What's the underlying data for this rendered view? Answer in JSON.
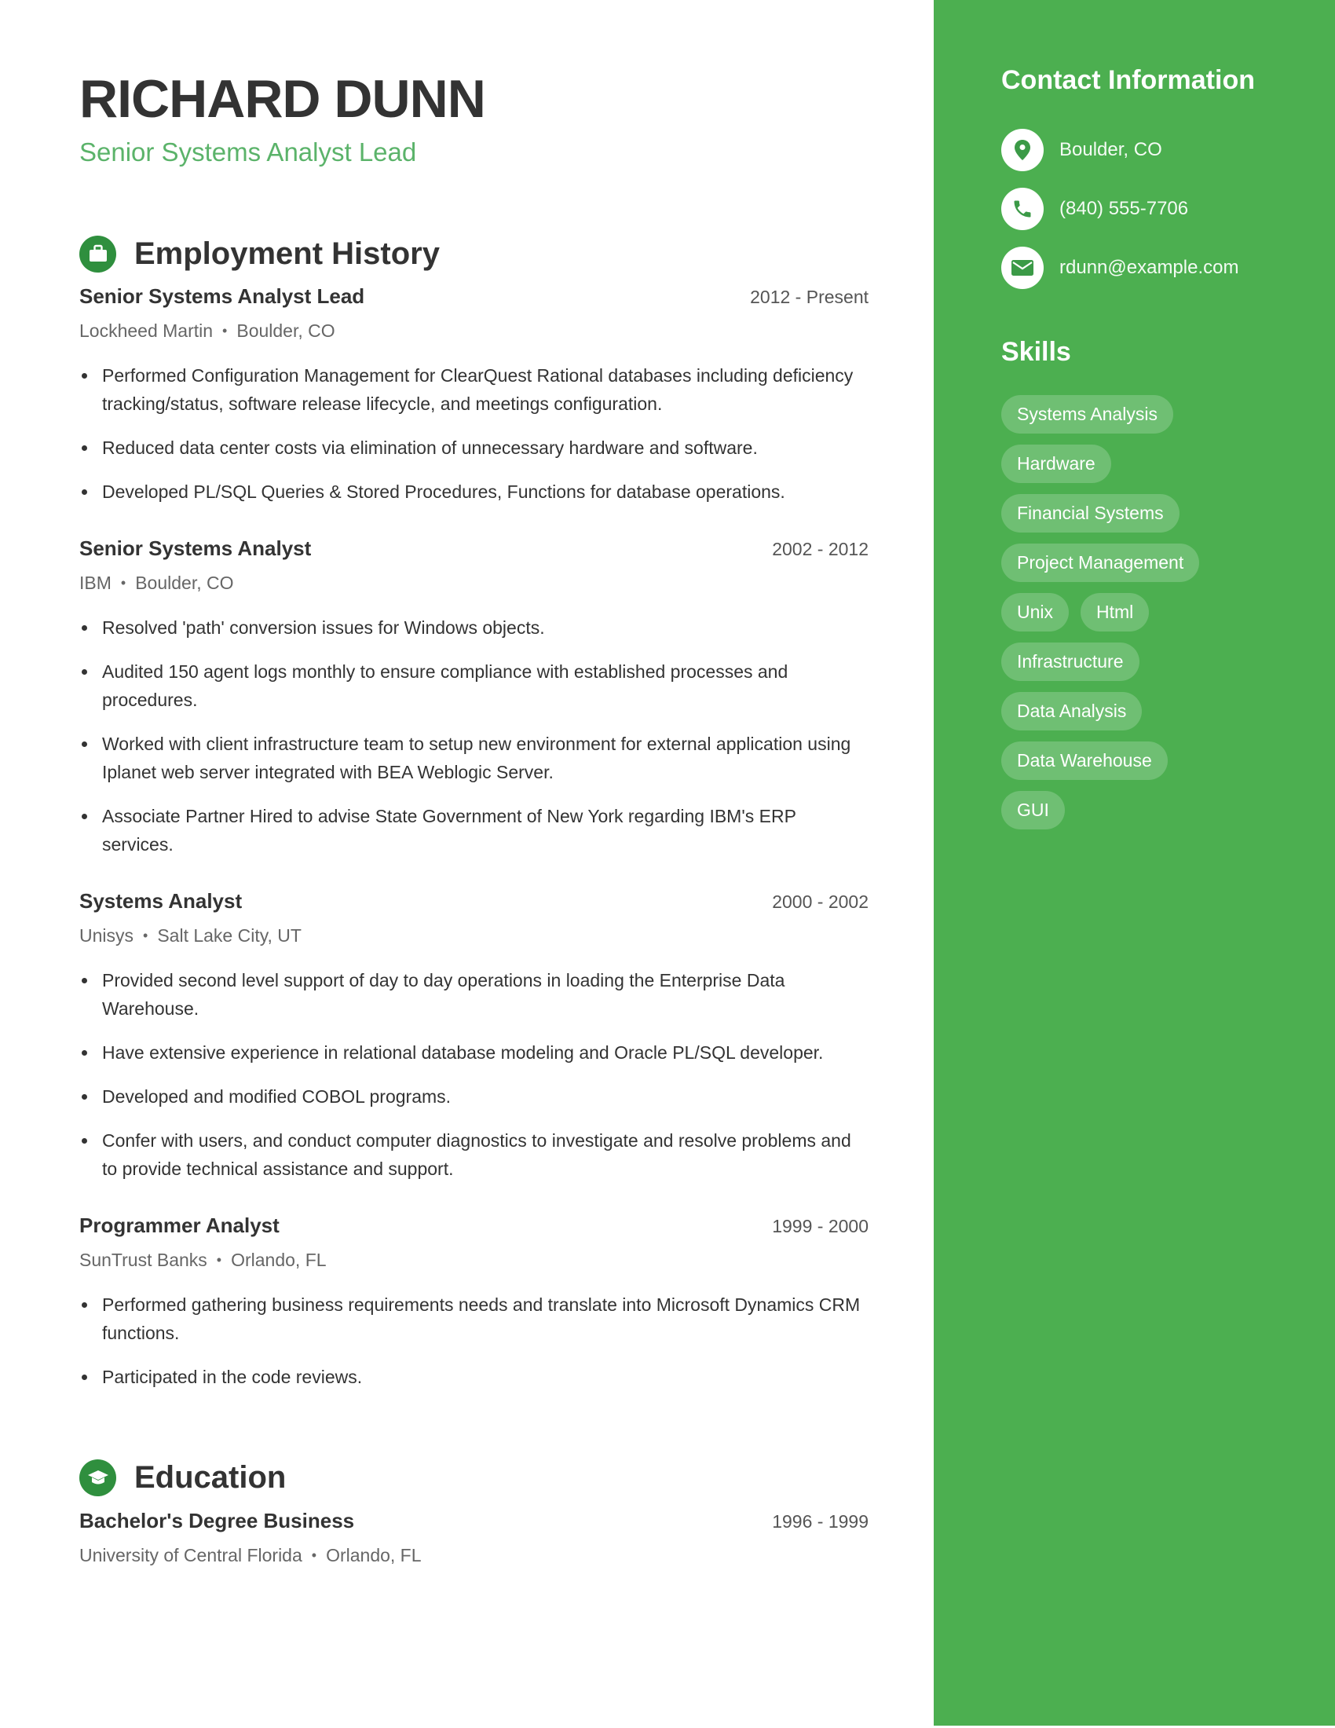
{
  "header": {
    "name": "RICHARD DUNN",
    "title": "Senior Systems Analyst Lead"
  },
  "employment": {
    "heading": "Employment History",
    "icon": "briefcase-icon",
    "jobs": [
      {
        "title": "Senior Systems Analyst Lead",
        "dates": "2012 - Present",
        "company": "Lockheed Martin",
        "location": "Boulder, CO",
        "bullets": [
          "Performed Configuration Management for ClearQuest Rational databases including deficiency tracking/status, software release lifecycle, and meetings configuration.",
          "Reduced data center costs via elimination of unnecessary hardware and software.",
          "Developed PL/SQL Queries & Stored Procedures, Functions for database operations."
        ]
      },
      {
        "title": "Senior Systems Analyst",
        "dates": "2002 - 2012",
        "company": "IBM",
        "location": "Boulder, CO",
        "bullets": [
          "Resolved 'path' conversion issues for Windows objects.",
          "Audited 150 agent logs monthly to ensure compliance with established processes and procedures.",
          "Worked with client infrastructure team to setup new environment for external application using Iplanet web server integrated with BEA Weblogic Server.",
          "Associate Partner Hired to advise State Government of New York regarding IBM's ERP services."
        ]
      },
      {
        "title": "Systems Analyst",
        "dates": "2000 - 2002",
        "company": "Unisys",
        "location": "Salt Lake City, UT",
        "bullets": [
          "Provided second level support of day to day operations in loading the Enterprise Data Warehouse.",
          "Have extensive experience in relational database modeling and Oracle PL/SQL developer.",
          "Developed and modified COBOL programs.",
          "Confer with users, and conduct computer diagnostics to investigate and resolve problems and to provide technical assistance and support."
        ]
      },
      {
        "title": "Programmer Analyst",
        "dates": "1999 - 2000",
        "company": "SunTrust Banks",
        "location": "Orlando, FL",
        "bullets": [
          "Performed gathering business requirements needs and translate into Microsoft Dynamics CRM functions.",
          "Participated in the code reviews."
        ]
      }
    ]
  },
  "education": {
    "heading": "Education",
    "icon": "graduation-cap-icon",
    "items": [
      {
        "degree": "Bachelor's Degree Business",
        "dates": "1996 - 1999",
        "school": "University of Central Florida",
        "location": "Orlando, FL"
      }
    ]
  },
  "sidebar": {
    "contact_heading": "Contact Information",
    "contacts": [
      {
        "icon": "location-pin-icon",
        "text": "Boulder, CO"
      },
      {
        "icon": "phone-icon",
        "text": "(840) 555-7706"
      },
      {
        "icon": "email-icon",
        "text": "rdunn@example.com"
      }
    ],
    "skills_heading": "Skills",
    "skills": [
      "Systems Analysis",
      "Hardware",
      "Financial Systems",
      "Project Management",
      "Unix",
      "Html",
      "Infrastructure",
      "Data Analysis",
      "Data Warehouse",
      "GUI"
    ]
  },
  "colors": {
    "accent": "#4caf50",
    "icon_circle": "#2f8f3e",
    "subtitle": "#5bb36a",
    "text": "#333333"
  }
}
